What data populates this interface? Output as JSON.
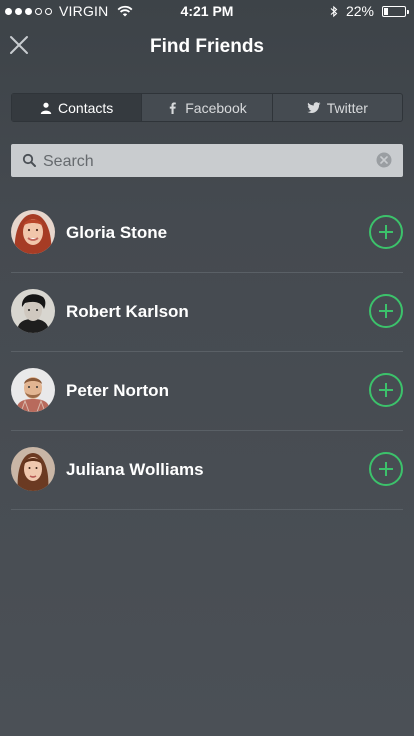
{
  "status_bar": {
    "carrier": "VIRGIN",
    "time": "4:21 PM",
    "battery": "22%",
    "signal_bars_filled": 3,
    "signal_bars_total": 5,
    "battery_level": 0.22
  },
  "nav": {
    "title": "Find Friends",
    "close_icon": "close-icon"
  },
  "tabs": [
    {
      "label": "Contacts",
      "icon": "person-icon",
      "active": true
    },
    {
      "label": "Facebook",
      "icon": "facebook-icon",
      "active": false
    },
    {
      "label": "Twitter",
      "icon": "twitter-bird-icon",
      "active": false
    }
  ],
  "search": {
    "placeholder": "Search",
    "value": ""
  },
  "contacts": [
    {
      "name": "Gloria Stone"
    },
    {
      "name": "Robert Karlson"
    },
    {
      "name": "Peter Norton"
    },
    {
      "name": "Juliana Wolliams"
    }
  ],
  "colors": {
    "accent_green": "#3cc26b",
    "background": "#4a4f55",
    "search_field": "#c9cccf"
  }
}
